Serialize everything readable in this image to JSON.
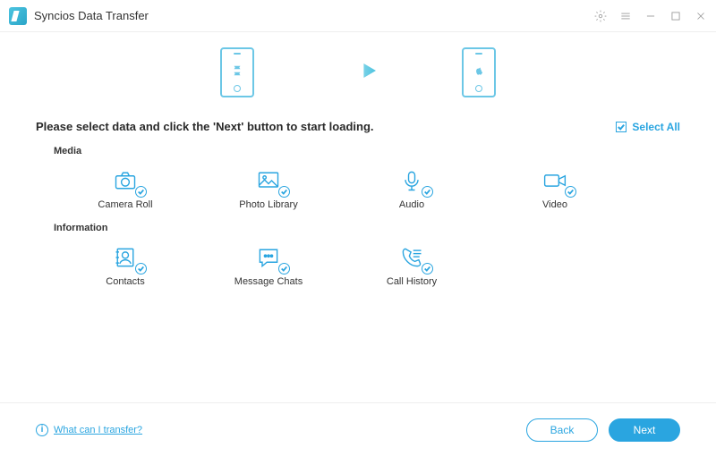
{
  "title": "Syncios Data Transfer",
  "hero": {
    "source_platform": "android",
    "target_platform": "ios"
  },
  "instruction": "Please select data and click the 'Next' button to start loading.",
  "select_all_label": "Select All",
  "select_all_checked": true,
  "sections": {
    "media": {
      "label": "Media",
      "items": [
        {
          "icon": "camera-roll-icon",
          "label": "Camera Roll"
        },
        {
          "icon": "photo-library-icon",
          "label": "Photo Library"
        },
        {
          "icon": "audio-icon",
          "label": "Audio"
        },
        {
          "icon": "video-icon",
          "label": "Video"
        }
      ]
    },
    "information": {
      "label": "Information",
      "items": [
        {
          "icon": "contacts-icon",
          "label": "Contacts"
        },
        {
          "icon": "message-chats-icon",
          "label": "Message Chats"
        },
        {
          "icon": "call-history-icon",
          "label": "Call History"
        }
      ]
    }
  },
  "footer": {
    "help_text": "What can I transfer?",
    "back_label": "Back",
    "next_label": "Next"
  }
}
